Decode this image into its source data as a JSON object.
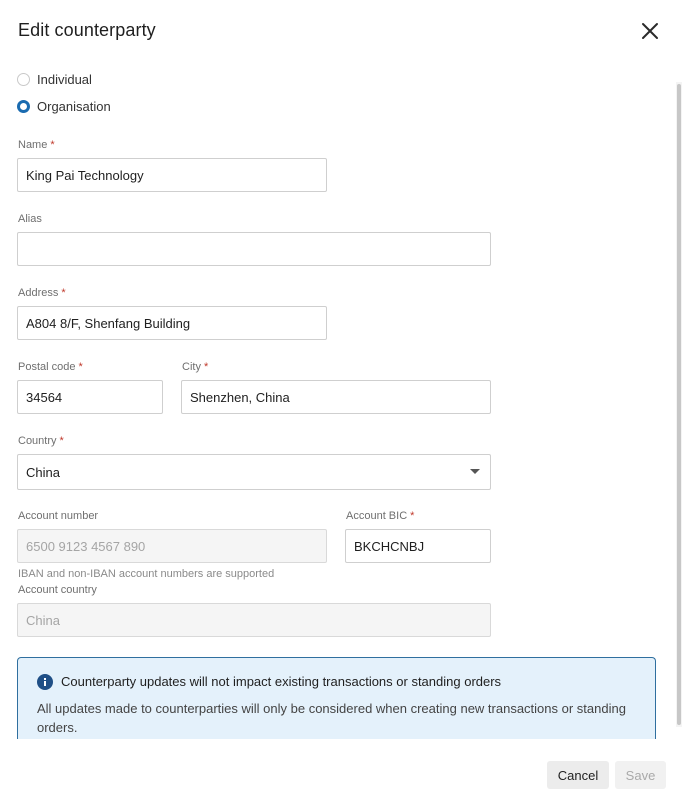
{
  "dialog": {
    "title": "Edit counterparty"
  },
  "type_options": {
    "individual": "Individual",
    "organisation": "Organisation",
    "selected": "Organisation"
  },
  "fields": {
    "required_mark": "*",
    "name": {
      "label": "Name",
      "value": "King Pai Technology"
    },
    "alias": {
      "label": "Alias",
      "value": ""
    },
    "address": {
      "label": "Address",
      "value": "A804 8/F, Shenfang Building"
    },
    "postal_code": {
      "label": "Postal code",
      "value": "34564"
    },
    "city": {
      "label": "City",
      "value": "Shenzhen, China"
    },
    "country": {
      "label": "Country",
      "value": "China"
    },
    "account_number": {
      "label": "Account number",
      "placeholder": "6500 9123 4567 890",
      "hint": "IBAN and non-IBAN account numbers are supported"
    },
    "account_bic": {
      "label": "Account BIC",
      "value": "BKCHCNBJ"
    },
    "account_country": {
      "label": "Account country",
      "placeholder": "China"
    }
  },
  "notice": {
    "title": "Counterparty updates will not impact existing transactions or standing orders",
    "body": "All updates made to counterparties will only be considered when creating new transactions or standing orders."
  },
  "footer": {
    "cancel_label": "Cancel",
    "save_label": "Save"
  },
  "colors": {
    "accent": "#1a6bb0",
    "required": "#c0392b",
    "info_bg": "#e4f1fb",
    "info_border": "#2f6f9f"
  }
}
